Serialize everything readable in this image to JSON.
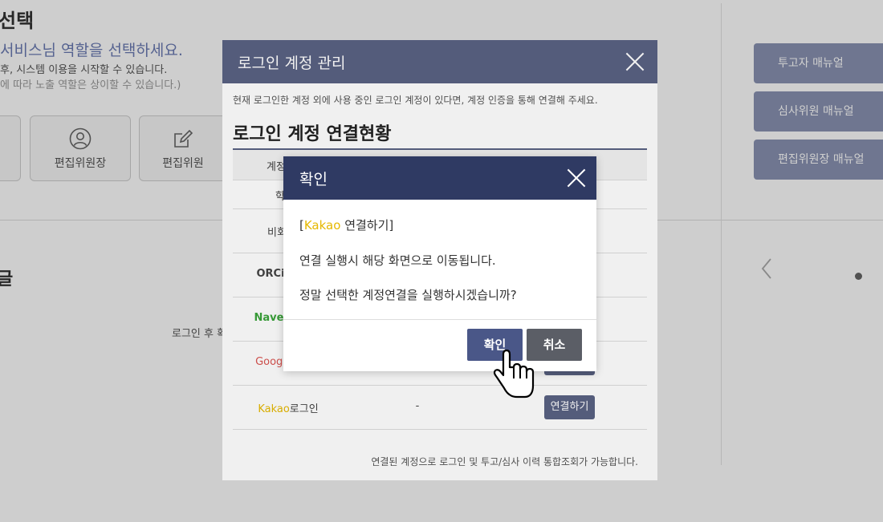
{
  "background": {
    "title": "선택",
    "subtitle": "서비스님 역할을 선택하세요.",
    "desc_line1": "후, 시스템 이용을 시작할 수 있습니다.",
    "desc_line2": "에 따라 노출 역할은 상이할 수 있습니다.)",
    "roles": [
      {
        "label": "편집위원장",
        "icon": "user-icon"
      },
      {
        "label": "편집위원",
        "icon": "edit-icon"
      }
    ],
    "section2_title": "글",
    "login_note": "로그인 후 확",
    "manuals": [
      "투고자 매뉴얼",
      "심사위원 매뉴얼",
      "편집위원장 매뉴얼"
    ]
  },
  "login_modal": {
    "title": "로그인 계정 관리",
    "description": "현재 로그인한 계정 외에 사용 중인 로그인 계정이 있다면, 계정 인증을 통해 연결해 주세요.",
    "subtitle": "로그인 계정 연결현황",
    "table_header": {
      "col1": "계정",
      "col2": "",
      "col3": ""
    },
    "rows": [
      {
        "name": "학회",
        "id": "",
        "button": ""
      },
      {
        "name": "비회원",
        "id": "",
        "button": ""
      },
      {
        "name": "ORCi",
        "id": "",
        "button": ""
      },
      {
        "name": "Nave",
        "id": "",
        "button": ""
      },
      {
        "name": "Google",
        "id": "",
        "button": ""
      },
      {
        "name_brand": "Kakao",
        "name_rest": "로그인",
        "id": "-",
        "button": "연결하기"
      }
    ],
    "footer_note": "연결된 계정으로 로그인 및 투고/심사 이력 통합조회가 가능합니다.",
    "colors": {
      "header": "#5a6283",
      "naver": "#3aa33a",
      "google": "#d9534f",
      "kakao": "#e6b800"
    }
  },
  "confirm_modal": {
    "title": "확인",
    "bracket_open": "[",
    "brand": "Kakao",
    "action": " 연결하기]",
    "line2": "연결 실행시 해당 화면으로 이동됩니다.",
    "line3": "정말 선택한 계정연결을 실행하시겠습니까?",
    "ok_label": "확인",
    "cancel_label": "취소",
    "colors": {
      "header": "#2f3a63",
      "ok": "#4a5788",
      "cancel": "#5b5e66"
    }
  },
  "cursor": "hand-pointer-icon"
}
